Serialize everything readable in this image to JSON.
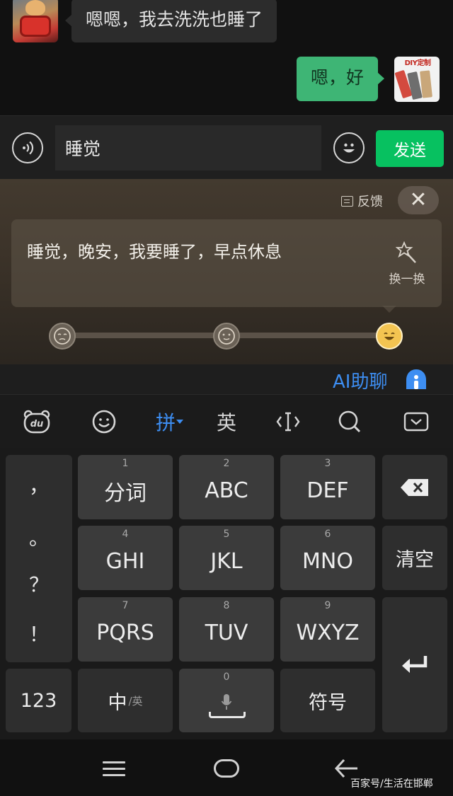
{
  "chat": {
    "incoming_message": "嗯嗯，我去洗洗也睡了",
    "outgoing_message": "嗯，好",
    "right_avatar_logo": "DIY定制"
  },
  "input_bar": {
    "input_value": "睡觉",
    "send_label": "发送"
  },
  "ai_panel": {
    "feedback_label": "反馈",
    "close_symbol": "✕",
    "suggestion": "睡觉，晚安，我要睡了，早点休息",
    "refresh_label": "换一换",
    "moods": [
      "sad",
      "neutral",
      "happy"
    ],
    "selected_mood": "happy"
  },
  "ai_bar": {
    "label": "AI助聊"
  },
  "toolbar": {
    "pinyin_label": "拼",
    "english_label": "英",
    "accent_color": "#3d8ef2"
  },
  "keyboard": {
    "punctuation": [
      "，",
      "。",
      "？",
      "！"
    ],
    "keys": [
      {
        "num": "1",
        "label": "分词"
      },
      {
        "num": "2",
        "label": "ABC"
      },
      {
        "num": "3",
        "label": "DEF"
      },
      {
        "num": "4",
        "label": "GHI"
      },
      {
        "num": "5",
        "label": "JKL"
      },
      {
        "num": "6",
        "label": "MNO"
      },
      {
        "num": "7",
        "label": "PQRS"
      },
      {
        "num": "8",
        "label": "TUV"
      },
      {
        "num": "9",
        "label": "WXYZ"
      }
    ],
    "clear_label": "清空",
    "numbers_label": "123",
    "chinese_label": "中",
    "chinese_sub_label": "/英",
    "space_num": "0",
    "symbols_label": "符号"
  },
  "watermark": "百家号/生活在邯郸"
}
